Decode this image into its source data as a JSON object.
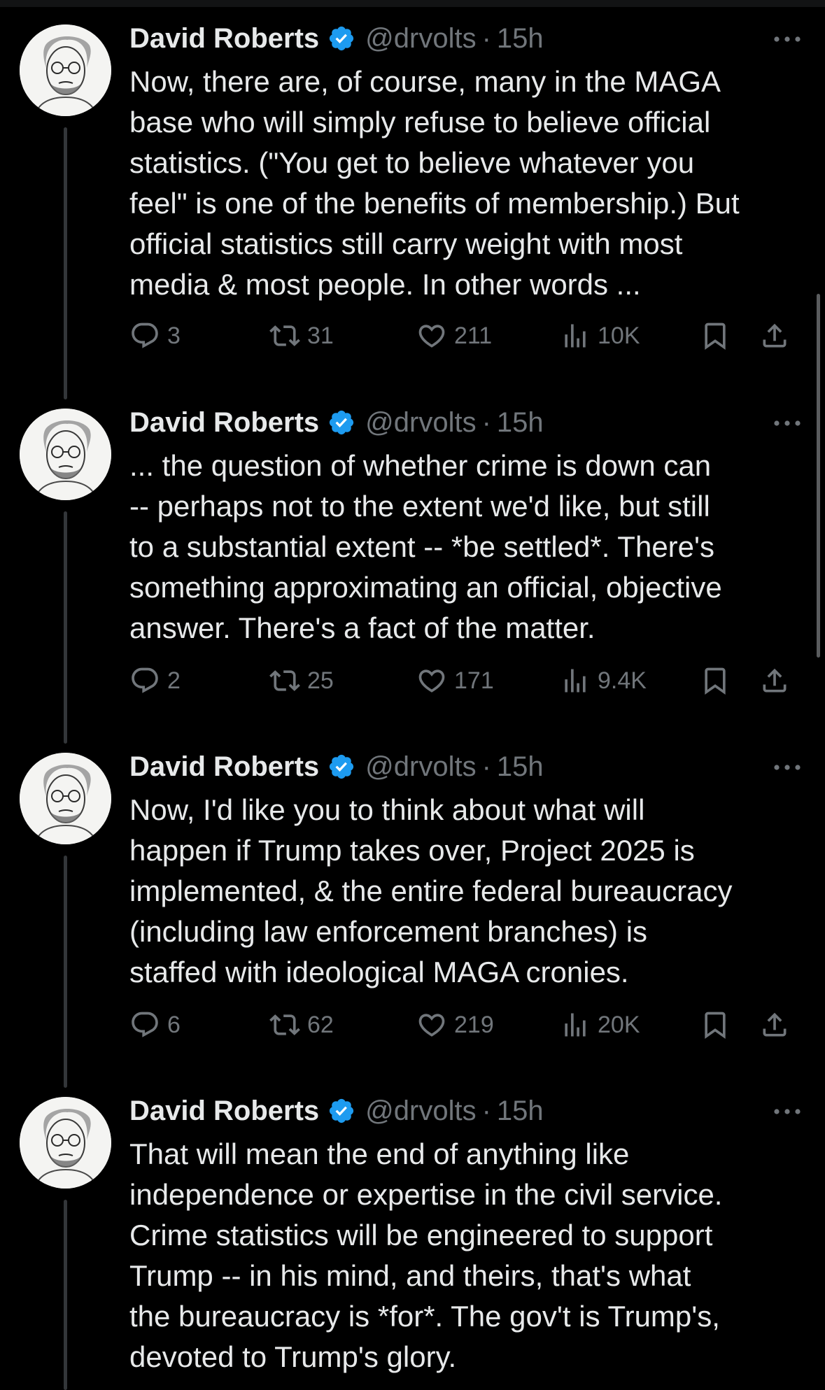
{
  "colors": {
    "background": "#000000",
    "text": "#e7e9ea",
    "secondary_text": "#71767b",
    "verified_badge": "#1d9bf0",
    "thread_line": "#333639"
  },
  "icons": {
    "verified": "verified-badge-icon",
    "more": "more-options-icon",
    "reply": "reply-icon",
    "repost": "repost-icon",
    "like": "heart-icon",
    "views": "views-chart-icon",
    "bookmark": "bookmark-icon",
    "share": "share-icon"
  },
  "tweets": [
    {
      "author": {
        "name": "David Roberts",
        "handle": "@drvolts",
        "separator": "·",
        "time": "15h"
      },
      "text_lines": [
        "Now, there are, of course, many in the MAGA",
        "base who will simply refuse to believe official",
        "statistics. (\"You get to believe whatever you",
        "feel\" is one of the benefits of membership.) But",
        "official statistics still carry weight with most",
        "media & most people. In other words ..."
      ],
      "stats": {
        "replies": "3",
        "reposts": "31",
        "likes": "211",
        "views": "10K"
      }
    },
    {
      "author": {
        "name": "David Roberts",
        "handle": "@drvolts",
        "separator": "·",
        "time": "15h"
      },
      "text_lines": [
        "... the question of whether crime is down can",
        "-- perhaps not to the extent we'd like, but still",
        "to a substantial extent -- *be settled*. There's",
        "something approximating an official, objective",
        "answer. There's a fact of the matter."
      ],
      "stats": {
        "replies": "2",
        "reposts": "25",
        "likes": "171",
        "views": "9.4K"
      }
    },
    {
      "author": {
        "name": "David Roberts",
        "handle": "@drvolts",
        "separator": "·",
        "time": "15h"
      },
      "text_lines": [
        "Now, I'd like you to think about what will",
        "happen if Trump takes over, Project 2025 is",
        "implemented, & the entire federal bureaucracy",
        "(including law enforcement branches) is",
        "staffed with ideological MAGA cronies."
      ],
      "stats": {
        "replies": "6",
        "reposts": "62",
        "likes": "219",
        "views": "20K"
      }
    },
    {
      "author": {
        "name": "David Roberts",
        "handle": "@drvolts",
        "separator": "·",
        "time": "15h"
      },
      "text_lines": [
        "That will mean the end of anything like",
        "independence or expertise in the civil service.",
        "Crime statistics will be engineered to support",
        "Trump -- in his mind, and theirs, that's what",
        "the bureaucracy is *for*. The gov't is Trump's,",
        "devoted to Trump's glory."
      ],
      "stats": null
    }
  ]
}
